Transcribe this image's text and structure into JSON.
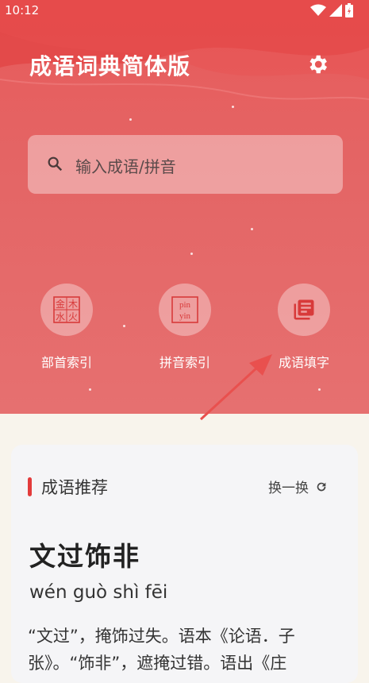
{
  "status_bar": {
    "time": "10:12"
  },
  "header": {
    "title": "成语词典简体版"
  },
  "search": {
    "placeholder": "输入成语/拼音"
  },
  "entries": [
    {
      "label": "部首索引",
      "icon": "radical-index-icon"
    },
    {
      "label": "拼音索引",
      "icon": "pinyin-index-icon"
    },
    {
      "label": "成语填字",
      "icon": "fill-word-icon"
    }
  ],
  "radical_glyphs": [
    "金",
    "木",
    "水",
    "火"
  ],
  "pinyin_glyph": {
    "top": "pin",
    "bottom": "yin"
  },
  "recommend": {
    "title": "成语推荐",
    "refresh_label": "换一换",
    "idiom": "文过饰非",
    "pinyin": "wén guò shì fēi",
    "description": "“文过”，掩饰过失。语本《论语．子张》。“饰非”，遮掩过错。语出《庄"
  },
  "colors": {
    "hero": "#e46565",
    "accent": "#e33b3b",
    "card": "#f5f5f7"
  }
}
